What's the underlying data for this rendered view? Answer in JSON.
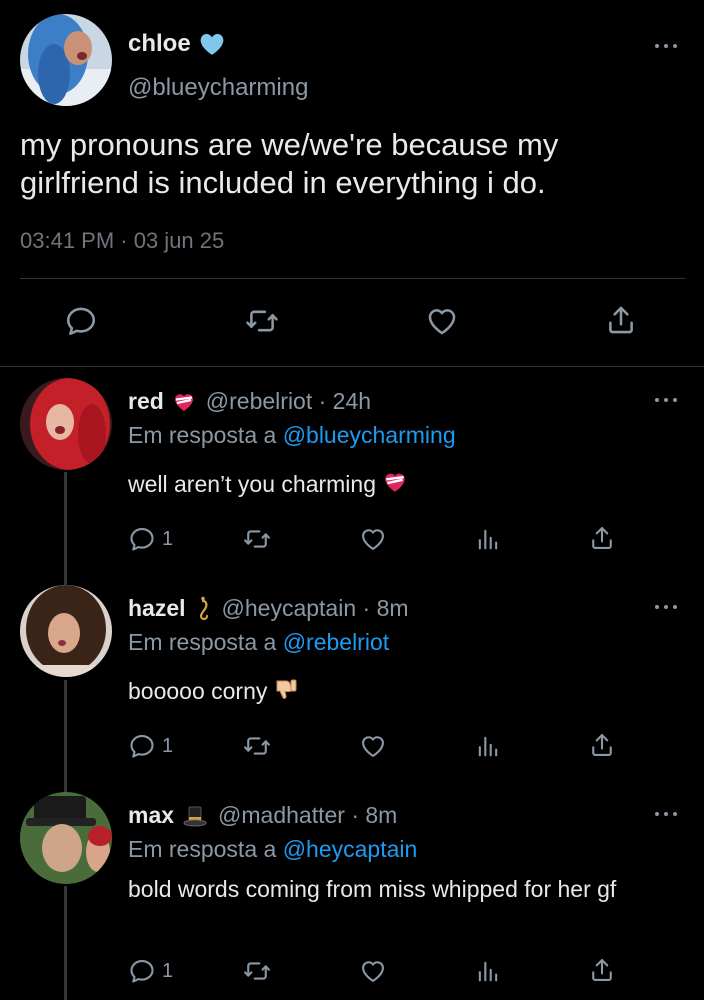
{
  "main_tweet": {
    "name": "chloe",
    "name_emoji_icon": "light-blue-heart-icon",
    "handle": "@blueycharming",
    "text": "my pronouns are we/we're because my girlfriend is included in everything i do.",
    "timestamp": "03:41 PM · 03 jun 25",
    "actions": [
      "reply-icon",
      "retweet-icon",
      "like-icon",
      "share-icon"
    ]
  },
  "replies": [
    {
      "name": "red",
      "name_emoji_icon": "heart-with-ribbon-icon",
      "handle_time": "@rebelriot · 24h",
      "replying_prefix": "Em resposta a",
      "replying_to": "@blueycharming",
      "text": "well aren’t you charming",
      "text_emoji_icon": "heart-with-ribbon-icon",
      "reply_count": "1"
    },
    {
      "name": "hazel",
      "name_emoji_icon": "hook-icon",
      "handle_time": "@heycaptain · 8m",
      "replying_prefix": "Em resposta a",
      "replying_to": "@rebelriot",
      "text": "booooo corny",
      "text_emoji_icon": "thumbs-down-icon",
      "reply_count": "1"
    },
    {
      "name": "max",
      "name_emoji_icon": "top-hat-icon",
      "handle_time": "@madhatter · 8m",
      "replying_prefix": "Em resposta a",
      "replying_to": "@heycaptain",
      "text": "bold words coming from miss whipped for her gf",
      "reply_count": "1"
    }
  ],
  "colors": {
    "background": "#000000",
    "text": "#e7e9ea",
    "secondary": "#8b98a5",
    "link": "#1d9bf0",
    "divider": "#2f3336"
  }
}
